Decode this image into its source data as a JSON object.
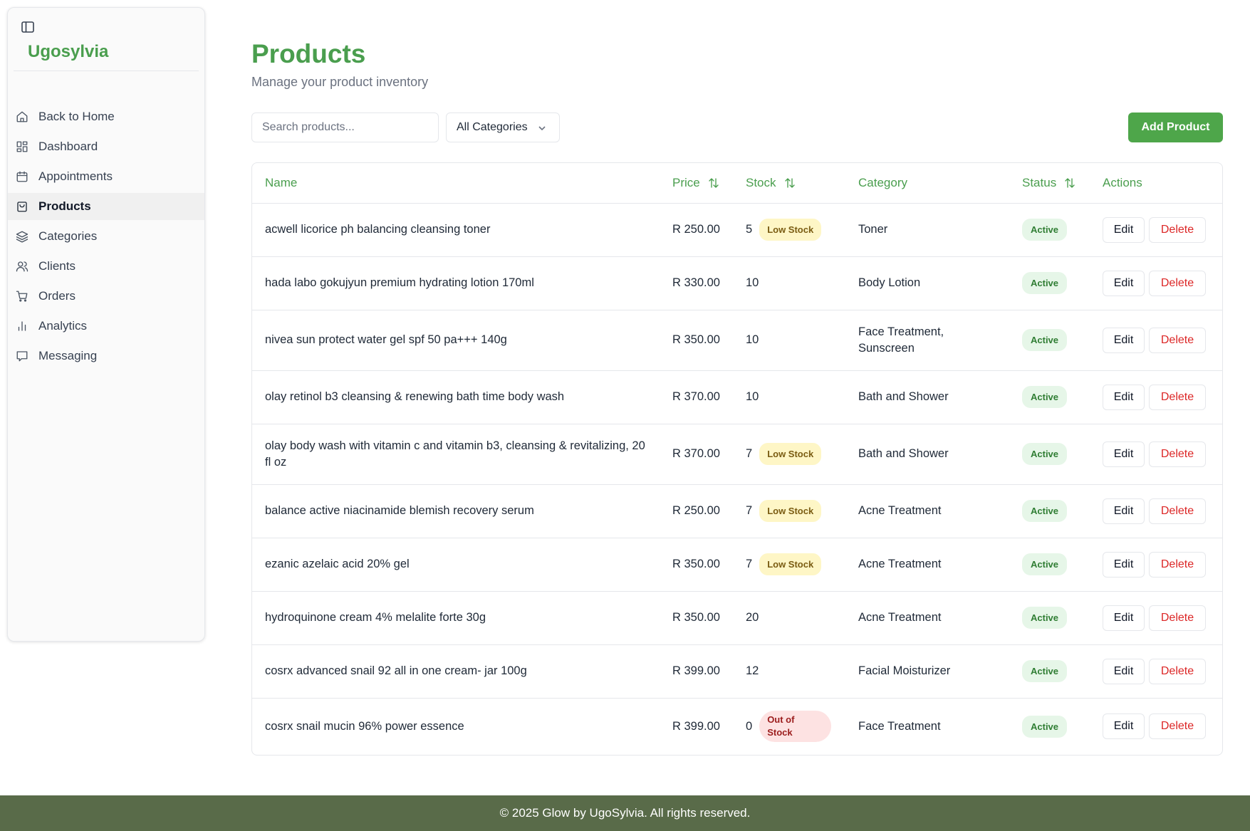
{
  "sidebar": {
    "brand": "Ugosylvia",
    "toggle_icon": "sidebar-toggle-icon",
    "items": [
      {
        "label": "Back to Home",
        "icon": "home-icon",
        "active": false
      },
      {
        "label": "Dashboard",
        "icon": "dashboard-grid-icon",
        "active": false
      },
      {
        "label": "Appointments",
        "icon": "calendar-icon",
        "active": false
      },
      {
        "label": "Products",
        "icon": "shopping-bag-icon",
        "active": true
      },
      {
        "label": "Categories",
        "icon": "layers-icon",
        "active": false
      },
      {
        "label": "Clients",
        "icon": "users-icon",
        "active": false
      },
      {
        "label": "Orders",
        "icon": "cart-icon",
        "active": false
      },
      {
        "label": "Analytics",
        "icon": "bar-chart-icon",
        "active": false
      },
      {
        "label": "Messaging",
        "icon": "message-icon",
        "active": false
      }
    ]
  },
  "header": {
    "title": "Products",
    "subtitle": "Manage your product inventory"
  },
  "toolbar": {
    "search_placeholder": "Search products...",
    "search_value": "",
    "category_selected": "All Categories",
    "add_label": "Add Product"
  },
  "table": {
    "columns": {
      "name": "Name",
      "price": "Price",
      "stock": "Stock",
      "category": "Category",
      "status": "Status",
      "actions": "Actions"
    },
    "edit_label": "Edit",
    "delete_label": "Delete",
    "rows": [
      {
        "name": "acwell licorice ph balancing cleansing toner",
        "price": "R 250.00",
        "stock": "5",
        "stock_badge": "Low Stock",
        "category": "Toner",
        "status": "Active"
      },
      {
        "name": "hada labo gokujyun premium hydrating lotion 170ml",
        "price": "R 330.00",
        "stock": "10",
        "stock_badge": "",
        "category": "Body Lotion",
        "status": "Active"
      },
      {
        "name": "nivea sun protect water gel spf 50 pa+++ 140g",
        "price": "R 350.00",
        "stock": "10",
        "stock_badge": "",
        "category": "Face Treatment, Sunscreen",
        "status": "Active"
      },
      {
        "name": "olay retinol b3 cleansing & renewing bath time body wash",
        "price": "R 370.00",
        "stock": "10",
        "stock_badge": "",
        "category": "Bath and Shower",
        "status": "Active"
      },
      {
        "name": "olay body wash with vitamin c and vitamin b3, cleansing & revitalizing, 20 fl oz",
        "price": "R 370.00",
        "stock": "7",
        "stock_badge": "Low Stock",
        "category": "Bath and Shower",
        "status": "Active"
      },
      {
        "name": "balance active niacinamide blemish recovery serum",
        "price": "R 250.00",
        "stock": "7",
        "stock_badge": "Low Stock",
        "category": "Acne Treatment",
        "status": "Active"
      },
      {
        "name": "ezanic azelaic acid 20% gel",
        "price": "R 350.00",
        "stock": "7",
        "stock_badge": "Low Stock",
        "category": "Acne Treatment",
        "status": "Active"
      },
      {
        "name": "hydroquinone cream 4% melalite forte 30g",
        "price": "R 350.00",
        "stock": "20",
        "stock_badge": "",
        "category": "Acne Treatment",
        "status": "Active"
      },
      {
        "name": "cosrx advanced snail 92 all in one cream- jar 100g",
        "price": "R 399.00",
        "stock": "12",
        "stock_badge": "",
        "category": "Facial Moisturizer",
        "status": "Active"
      },
      {
        "name": "cosrx snail mucin 96% power essence",
        "price": "R 399.00",
        "stock": "0",
        "stock_badge": "Out of Stock",
        "category": "Face Treatment",
        "status": "Active"
      }
    ]
  },
  "footer": {
    "text": "© 2025 Glow by UgoSylvia. All rights reserved."
  },
  "colors": {
    "accent": "#4a9e4e",
    "button": "#4ea64a",
    "footer_bg": "#596b49",
    "danger": "#dc2626"
  }
}
